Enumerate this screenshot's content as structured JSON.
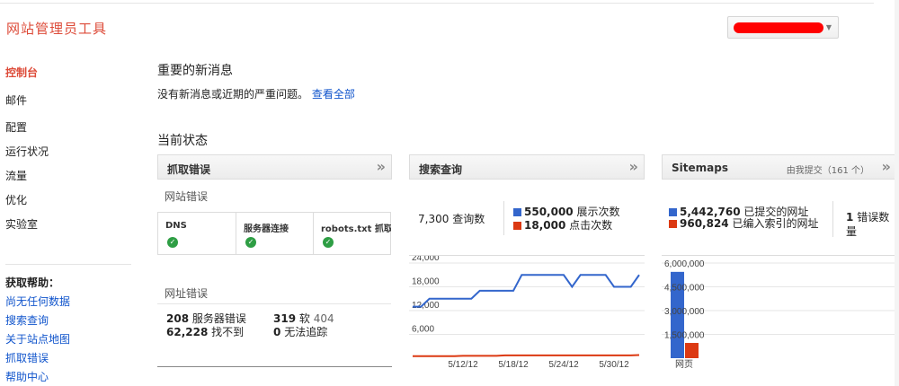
{
  "app_title": "网站管理员工具",
  "nav": {
    "items": [
      {
        "label": "控制台",
        "active": true
      },
      {
        "label": "邮件"
      },
      {
        "label": "配置"
      },
      {
        "label": "运行状况"
      },
      {
        "label": "流量"
      },
      {
        "label": "优化"
      },
      {
        "label": "实验室"
      }
    ]
  },
  "help": {
    "title": "获取帮助：",
    "links": [
      "尚无任何数据",
      "搜索查询",
      "关于站点地图",
      "抓取错误",
      "帮助中心"
    ]
  },
  "messages": {
    "title": "重要的新消息",
    "text": "没有新消息或近期的严重问题。",
    "link": "查看全部"
  },
  "status_title": "当前状态",
  "crawl_errors": {
    "title": "抓取错误",
    "site_errors_label": "网站错误",
    "columns": [
      "DNS",
      "服务器连接",
      "robots.txt 抓取"
    ],
    "url_errors_label": "网址错误",
    "stats": [
      {
        "value": "208",
        "label": "服务器错误"
      },
      {
        "value": "319",
        "label": "软",
        "muted": "404"
      },
      {
        "value": "62,228",
        "label": "找不到"
      },
      {
        "value": "0",
        "label": "无法追踪"
      }
    ]
  },
  "search_queries": {
    "title": "搜索查询",
    "queries": "7,300",
    "queries_label": "查询数",
    "impressions": "550,000",
    "impressions_label": "展示次数",
    "clicks": "18,000",
    "clicks_label": "点击次数",
    "colors": {
      "impressions": "#3366cc",
      "clicks": "#dc3912"
    }
  },
  "sitemaps": {
    "title": "Sitemaps",
    "subtitle": "由我提交（161 个）",
    "submitted": "5,442,760",
    "submitted_label": "已提交的网址",
    "indexed": "960,824",
    "indexed_label": "已编入索引的网址",
    "errors": "1",
    "errors_label": "错误数量",
    "colors": {
      "submitted": "#3366cc",
      "indexed": "#dc3912"
    }
  },
  "chart_data": [
    {
      "type": "line",
      "x": [
        "5/6/12",
        "5/7/12",
        "5/8/12",
        "5/9/12",
        "5/10/12",
        "5/11/12",
        "5/12/12",
        "5/13/12",
        "5/14/12",
        "5/15/12",
        "5/16/12",
        "5/17/12",
        "5/18/12",
        "5/19/12",
        "5/20/12",
        "5/21/12",
        "5/22/12",
        "5/23/12",
        "5/24/12",
        "5/25/12",
        "5/26/12",
        "5/27/12",
        "5/28/12",
        "5/29/12",
        "5/30/12",
        "5/31/12",
        "6/1/12",
        "6/2/12"
      ],
      "x_tick_labels": [
        "5/12/12",
        "5/18/12",
        "5/24/12",
        "5/30/12"
      ],
      "y_tick_labels": [
        "24,000",
        "18,000",
        "12,000",
        "6,000"
      ],
      "ylim": [
        0,
        24000
      ],
      "series": [
        {
          "values": [
            13000,
            13000,
            15000,
            15000,
            15000,
            15000,
            15000,
            15000,
            17000,
            17000,
            17000,
            17000,
            17000,
            21000,
            21000,
            21000,
            21000,
            21000,
            21000,
            18000,
            21000,
            21000,
            21000,
            21000,
            18000,
            18000,
            18000,
            21000
          ]
        },
        {
          "values": [
            500,
            500,
            500,
            500,
            500,
            500,
            600,
            600,
            600,
            600,
            600,
            700,
            700,
            700,
            700,
            700,
            700,
            700,
            700,
            700,
            700,
            700,
            700,
            700,
            700,
            700,
            700,
            800
          ]
        }
      ]
    },
    {
      "type": "bar",
      "categories": [
        "网页"
      ],
      "y_tick_labels": [
        "6,000,000",
        "4,500,000",
        "3,000,000",
        "1,500,000"
      ],
      "ylim": [
        0,
        6000000
      ],
      "series": [
        {
          "name": "已提交的网址",
          "values": [
            5442760
          ]
        },
        {
          "name": "已编入索引的网址",
          "values": [
            960824
          ]
        }
      ]
    }
  ]
}
